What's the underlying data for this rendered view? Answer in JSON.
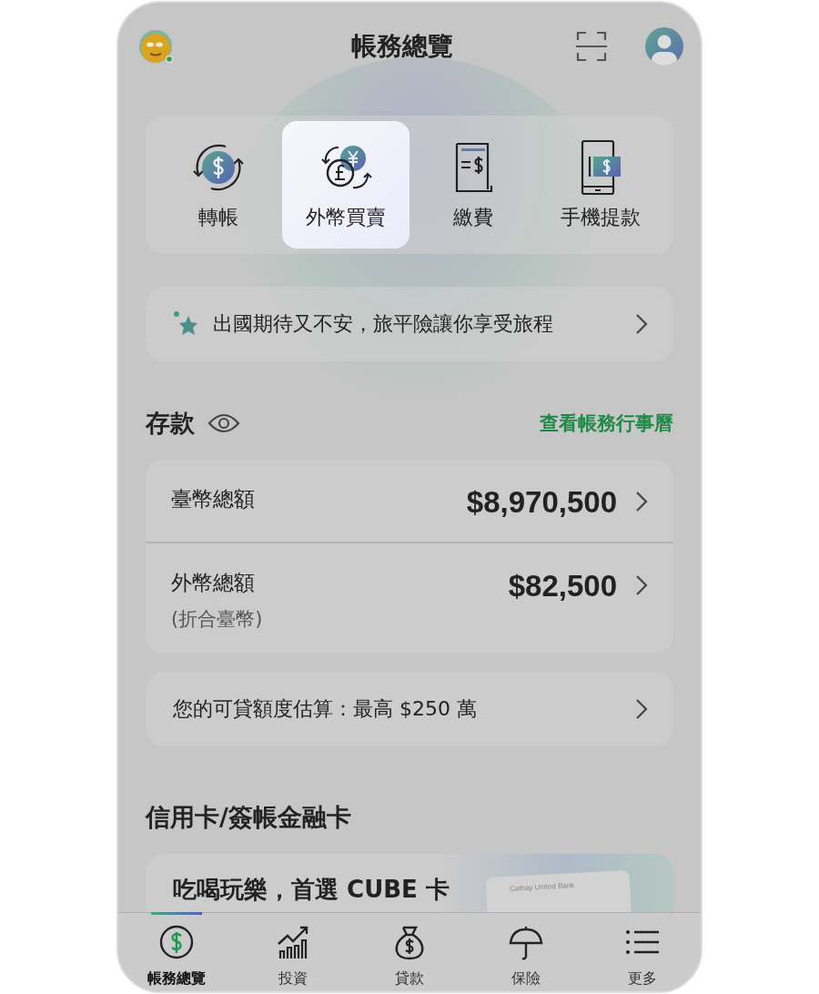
{
  "header": {
    "title": "帳務總覽"
  },
  "quick_actions": [
    {
      "label": "轉帳",
      "kind": "transfer",
      "selected": false
    },
    {
      "label": "外幣買賣",
      "kind": "exchange",
      "selected": true
    },
    {
      "label": "繳費",
      "kind": "bill",
      "selected": false
    },
    {
      "label": "手機提款",
      "kind": "withdraw",
      "selected": false
    }
  ],
  "banner": {
    "text": "出國期待又不安，旅平險讓你享受旅程"
  },
  "deposits": {
    "title": "存款",
    "link": "查看帳務行事曆",
    "rows": [
      {
        "label": "臺幣總額",
        "amount": "$8,970,500"
      },
      {
        "label": "外幣總額",
        "note": "(折合臺幣)",
        "amount": "$82,500"
      }
    ]
  },
  "loan": {
    "text": "您的可貸額度估算：最高 $250 萬"
  },
  "cards": {
    "title": "信用卡/簽帳金融卡",
    "promo_title": "吃喝玩樂，首選 CUBE 卡",
    "card_bank": "Cathay United Bank"
  },
  "nav": [
    {
      "label": "帳務總覽",
      "kind": "overview",
      "selected": true
    },
    {
      "label": "投資",
      "kind": "invest",
      "selected": false
    },
    {
      "label": "貸款",
      "kind": "loan",
      "selected": false
    },
    {
      "label": "保險",
      "kind": "insurance",
      "selected": false
    },
    {
      "label": "更多",
      "kind": "more",
      "selected": false
    }
  ]
}
